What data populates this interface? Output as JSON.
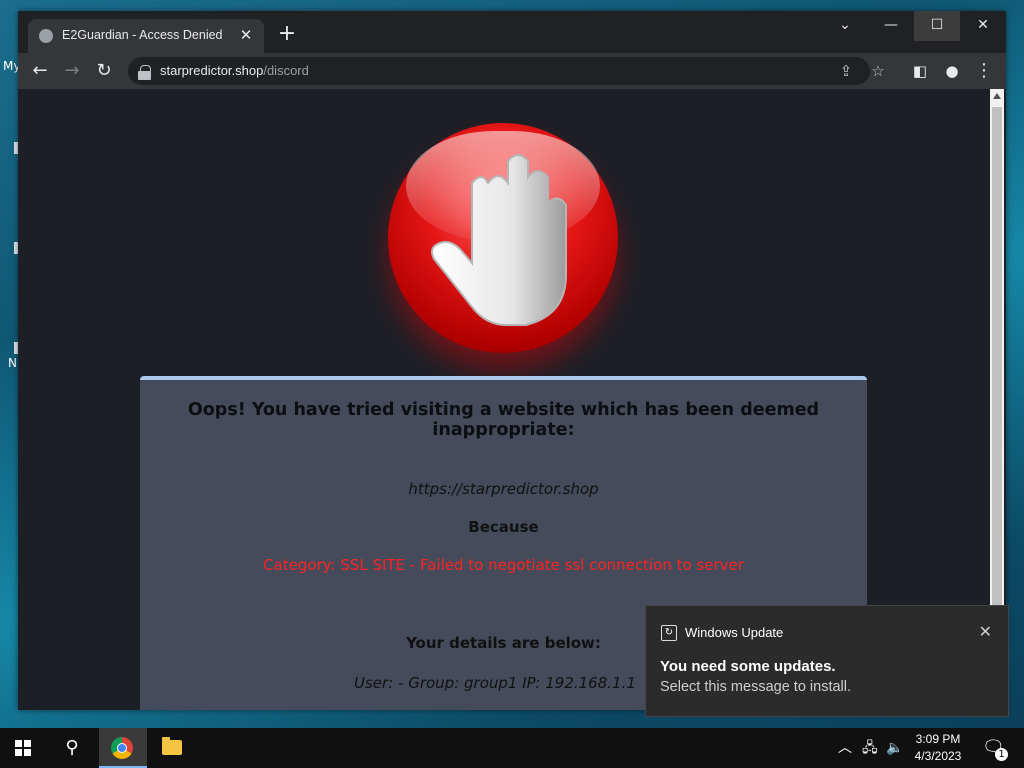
{
  "desktop": {
    "icon_label_1": "My",
    "icon_label_2": "N"
  },
  "browser": {
    "tab": {
      "title": "E2Guardian - Access Denied",
      "favicon": "globe-icon"
    },
    "new_tab_label": "+",
    "window_controls": [
      "chevron-down-icon",
      "minimize-icon",
      "maximize-icon",
      "close-icon"
    ],
    "address": {
      "host": "starpredictor.shop",
      "path": "/discord"
    }
  },
  "page": {
    "headline": "Oops! You have tried visiting a website which has been deemed inappropriate:",
    "blocked_url": "https://starpredictor.shop",
    "because_label": "Because",
    "reason": "Category: SSL SITE - Failed to negotiate ssl connection to server",
    "details_heading": "Your details are below:",
    "details": "User: -   Group: group1   IP: 192.168.1.1",
    "reason_color": "#ff2222"
  },
  "notification": {
    "app_name": "Windows Update",
    "title": "You need some updates.",
    "body": "Select this message to install."
  },
  "taskbar": {
    "time": "3:09 PM",
    "date": "4/3/2023",
    "notification_count": "1"
  }
}
